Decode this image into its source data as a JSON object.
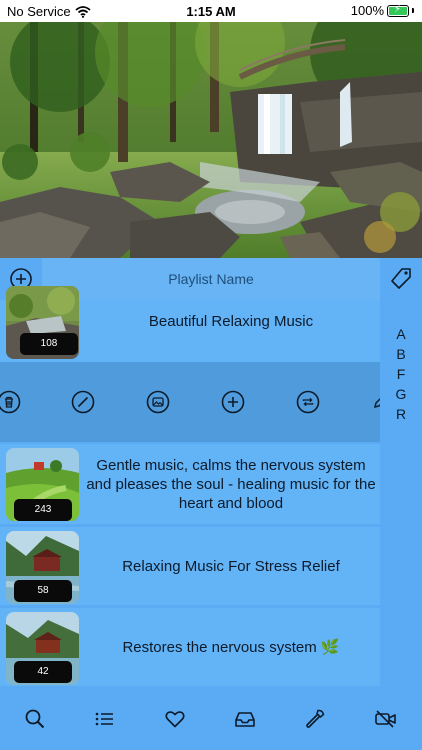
{
  "status_bar": {
    "carrier": "No Service",
    "time": "1:15 AM",
    "battery": "100%",
    "battery_color": "#34c759"
  },
  "toolbar": {
    "playlist_name_placeholder": "Playlist Name",
    "add_icon": "plus-circle-icon",
    "tag_icon": "tag-icon"
  },
  "playlists": [
    {
      "title": "Beautiful Relaxing Music",
      "count": "108"
    },
    {
      "title": "Gentle music, calms the nervous system and pleases the soul - healing music for the heart and blood",
      "count": "243"
    },
    {
      "title": "Relaxing Music For Stress Relief",
      "count": "58"
    },
    {
      "title": "Restores the nervous system 🌿",
      "count": "42"
    }
  ],
  "row_actions": [
    "trash-icon",
    "block-icon",
    "image-icon",
    "plus-circle-icon",
    "repeat-icon",
    "edit-icon"
  ],
  "index_letters": [
    "A",
    "B",
    "F",
    "G",
    "R"
  ],
  "tab_bar": [
    "search-icon",
    "list-icon",
    "heart-icon",
    "inbox-icon",
    "wrench-icon",
    "video-off-icon"
  ],
  "colors": {
    "background": "#5aabf3",
    "row": "#63b3f7",
    "action_strip": "#4f9bdc"
  }
}
